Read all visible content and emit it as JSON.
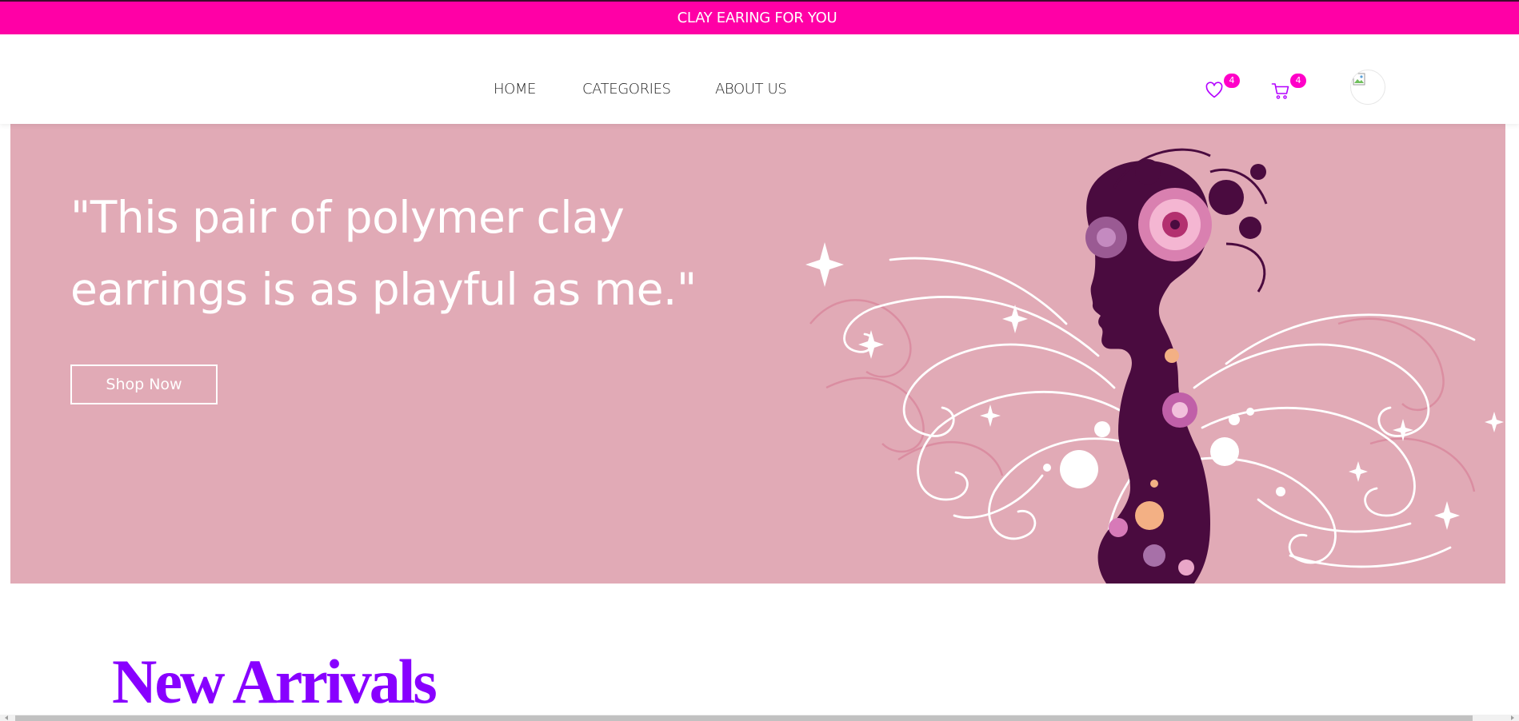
{
  "announcement": {
    "text": "CLAY EARING FOR YOU"
  },
  "nav": {
    "items": [
      {
        "label": "HOME"
      },
      {
        "label": "CATEGORIES"
      },
      {
        "label": "ABOUT US"
      }
    ],
    "wishlist": {
      "icon": "heart-icon",
      "count": "4"
    },
    "cart": {
      "icon": "cart-icon",
      "count": "4"
    },
    "avatar": {
      "icon": "broken-image-icon"
    }
  },
  "hero": {
    "quote": "\"This pair of polymer clay earrings is as playful as me.\"",
    "cta_label": "Shop Now",
    "background_color": "#e1aab6",
    "illustration": "woman-silhouette-with-flowers"
  },
  "sections": {
    "new_arrivals_title": "New Arrivals"
  },
  "colors": {
    "announcement_bg": "#ff00a6",
    "accent_pink": "#ff00c8",
    "icon_purple": "#b300ff",
    "title_purple": "#8800ff",
    "silhouette": "#4a0b3f"
  }
}
